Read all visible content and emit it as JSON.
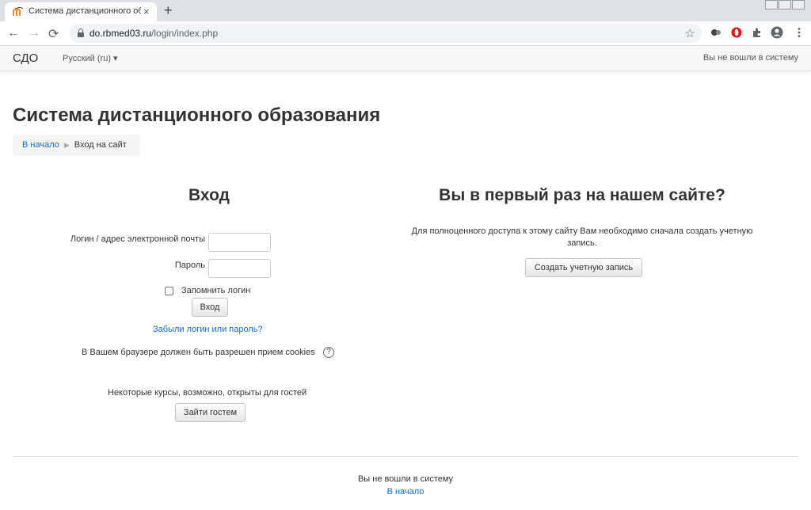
{
  "browser": {
    "tab_title": "Система дистанционного образ",
    "tab_close": "×",
    "new_tab": "+",
    "url_host": "do.rbmed03.ru",
    "url_path": "/login/index.php",
    "back_icon": "←",
    "forward_icon": "→",
    "reload_icon": "⟳",
    "star_icon": "☆"
  },
  "navbar": {
    "brand": "СДО",
    "language": "Русский (ru) ▾",
    "status": "Вы не вошли в систему"
  },
  "page": {
    "title": "Система дистанционного образования",
    "breadcrumb": {
      "home": "В начало",
      "separator": "▶",
      "current": "Вход на сайт"
    }
  },
  "login": {
    "heading": "Вход",
    "username_label": "Логин / адрес электронной почты",
    "username_value": "",
    "password_label": "Пароль",
    "password_value": "",
    "remember_label": "Запомнить логин",
    "remember_checked": false,
    "submit": "Вход",
    "forgot": "Забыли логин или пароль?",
    "cookies_notice": "В Вашем браузере должен быть разрешен прием cookies",
    "help_icon": "?",
    "guest_notice": "Некоторые курсы, возможно, открыты для гостей",
    "guest_button": "Зайти гостем"
  },
  "signup": {
    "heading": "Вы в первый раз на нашем сайте?",
    "description": "Для полноценного доступа к этому сайту Вам необходимо сначала создать учетную запись.",
    "button": "Создать учетную запись"
  },
  "footer": {
    "status": "Вы не вошли в систему",
    "home_link": "В начало"
  },
  "colors": {
    "link": "#0f6cbf",
    "text": "#333333",
    "navbar_bg": "#f7f7f7"
  }
}
